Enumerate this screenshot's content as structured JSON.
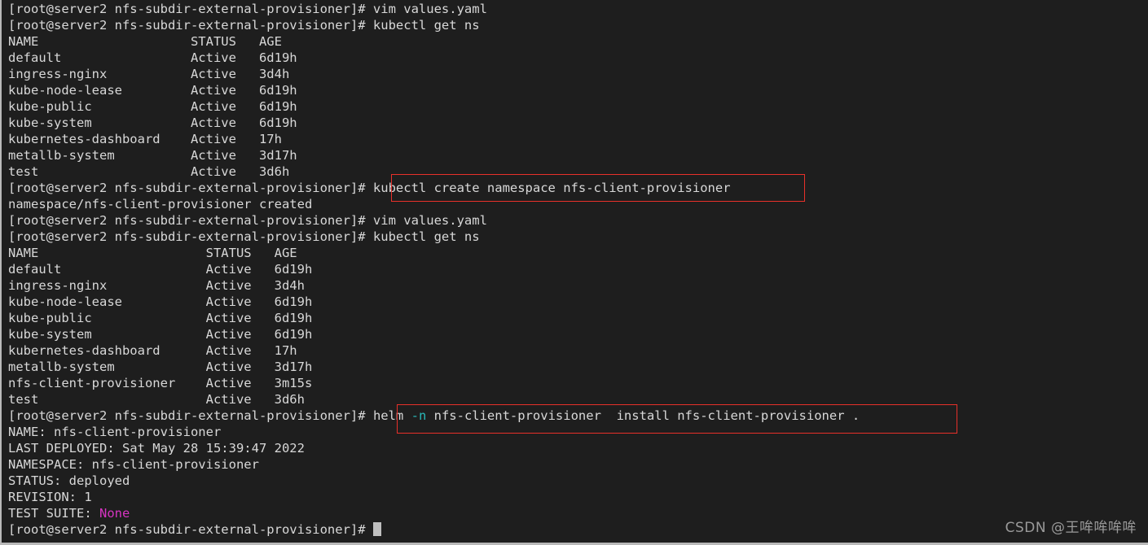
{
  "terminal": {
    "background_color": "#1e1e1e",
    "foreground_color": "#d8d8d8",
    "cursor_color": "#bfbfbf",
    "highlight_color": "#e8302a",
    "accent_cyan": "#29b8b8",
    "accent_magenta": "#d734c2",
    "prompt": "[root@server2 nfs-subdir-external-provisioner]#",
    "lines": [
      {
        "id": "l1",
        "text": "[root@server2 nfs-subdir-external-provisioner]# vim values.yaml"
      },
      {
        "id": "l2",
        "text": "[root@server2 nfs-subdir-external-provisioner]# kubectl get ns"
      },
      {
        "id": "l3",
        "text": "NAME                    STATUS   AGE"
      },
      {
        "id": "l4",
        "text": "default                 Active   6d19h"
      },
      {
        "id": "l5",
        "text": "ingress-nginx           Active   3d4h"
      },
      {
        "id": "l6",
        "text": "kube-node-lease         Active   6d19h"
      },
      {
        "id": "l7",
        "text": "kube-public             Active   6d19h"
      },
      {
        "id": "l8",
        "text": "kube-system             Active   6d19h"
      },
      {
        "id": "l9",
        "text": "kubernetes-dashboard    Active   17h"
      },
      {
        "id": "l10",
        "text": "metallb-system          Active   3d17h"
      },
      {
        "id": "l11",
        "text": "test                    Active   3d6h"
      },
      {
        "id": "l12",
        "text": "[root@server2 nfs-subdir-external-provisioner]# kubectl create namespace nfs-client-provisioner"
      },
      {
        "id": "l13",
        "text": "namespace/nfs-client-provisioner created"
      },
      {
        "id": "l14",
        "text": "[root@server2 nfs-subdir-external-provisioner]# vim values.yaml"
      },
      {
        "id": "l15",
        "text": "[root@server2 nfs-subdir-external-provisioner]# kubectl get ns"
      },
      {
        "id": "l16",
        "text": "NAME                      STATUS   AGE"
      },
      {
        "id": "l17",
        "text": "default                   Active   6d19h"
      },
      {
        "id": "l18",
        "text": "ingress-nginx             Active   3d4h"
      },
      {
        "id": "l19",
        "text": "kube-node-lease           Active   6d19h"
      },
      {
        "id": "l20",
        "text": "kube-public               Active   6d19h"
      },
      {
        "id": "l21",
        "text": "kube-system               Active   6d19h"
      },
      {
        "id": "l22",
        "text": "kubernetes-dashboard      Active   17h"
      },
      {
        "id": "l23",
        "text": "metallb-system            Active   3d17h"
      },
      {
        "id": "l24",
        "text": "nfs-client-provisioner    Active   3m15s"
      },
      {
        "id": "l25",
        "text": "test                      Active   3d6h"
      },
      {
        "id": "l26_prompt",
        "text": "[root@server2 nfs-subdir-external-provisioner]# "
      },
      {
        "id": "l26_cmd_a",
        "text": "helm "
      },
      {
        "id": "l26_cmd_flag",
        "text": "-n"
      },
      {
        "id": "l26_cmd_b",
        "text": " nfs-client-provisioner  install nfs-client-provisioner ."
      },
      {
        "id": "l27",
        "text": "NAME: nfs-client-provisioner"
      },
      {
        "id": "l28",
        "text": "LAST DEPLOYED: Sat May 28 15:39:47 2022"
      },
      {
        "id": "l29",
        "text": "NAMESPACE: nfs-client-provisioner"
      },
      {
        "id": "l30",
        "text": "STATUS: deployed"
      },
      {
        "id": "l31",
        "text": "REVISION: 1"
      },
      {
        "id": "l32_label",
        "text": "TEST SUITE: "
      },
      {
        "id": "l32_value",
        "text": "None"
      },
      {
        "id": "l33",
        "text": "[root@server2 nfs-subdir-external-provisioner]# "
      }
    ],
    "commands": {
      "vim_values": "vim values.yaml",
      "kubectl_get_ns": "kubectl get ns",
      "kubectl_create_ns": "kubectl create namespace nfs-client-provisioner",
      "helm_install": "helm -n nfs-client-provisioner  install nfs-client-provisioner ."
    },
    "namespace_table_1": {
      "columns": [
        "NAME",
        "STATUS",
        "AGE"
      ],
      "rows": [
        [
          "default",
          "Active",
          "6d19h"
        ],
        [
          "ingress-nginx",
          "Active",
          "3d4h"
        ],
        [
          "kube-node-lease",
          "Active",
          "6d19h"
        ],
        [
          "kube-public",
          "Active",
          "6d19h"
        ],
        [
          "kube-system",
          "Active",
          "6d19h"
        ],
        [
          "kubernetes-dashboard",
          "Active",
          "17h"
        ],
        [
          "metallb-system",
          "Active",
          "3d17h"
        ],
        [
          "test",
          "Active",
          "3d6h"
        ]
      ]
    },
    "namespace_table_2": {
      "columns": [
        "NAME",
        "STATUS",
        "AGE"
      ],
      "rows": [
        [
          "default",
          "Active",
          "6d19h"
        ],
        [
          "ingress-nginx",
          "Active",
          "3d4h"
        ],
        [
          "kube-node-lease",
          "Active",
          "6d19h"
        ],
        [
          "kube-public",
          "Active",
          "6d19h"
        ],
        [
          "kube-system",
          "Active",
          "6d19h"
        ],
        [
          "kubernetes-dashboard",
          "Active",
          "17h"
        ],
        [
          "metallb-system",
          "Active",
          "3d17h"
        ],
        [
          "nfs-client-provisioner",
          "Active",
          "3m15s"
        ],
        [
          "test",
          "Active",
          "3d6h"
        ]
      ]
    },
    "helm_release_info": {
      "name": "nfs-client-provisioner",
      "last_deployed": "Sat May 28 15:39:47 2022",
      "namespace": "nfs-client-provisioner",
      "status": "deployed",
      "revision": "1",
      "test_suite": "None"
    }
  },
  "watermark": {
    "text": "CSDN @王哞哞哞哞"
  }
}
